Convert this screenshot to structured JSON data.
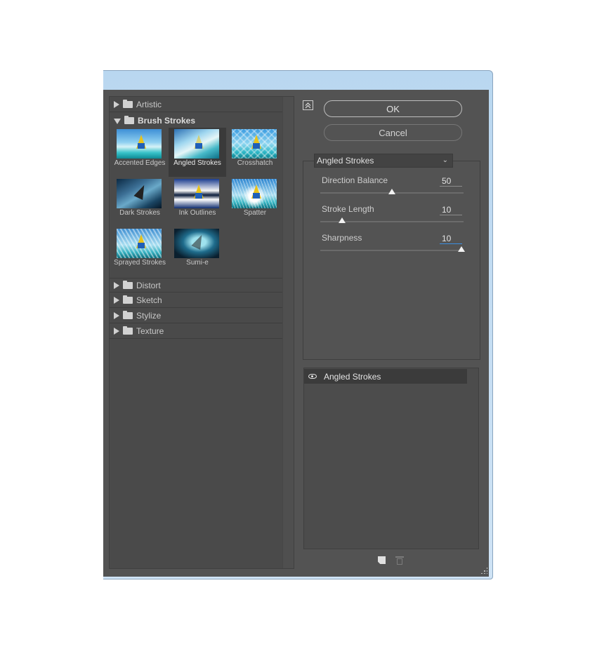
{
  "gallery": {
    "categories_top": [
      {
        "label": "Artistic",
        "expanded": false
      },
      {
        "label": "Brush Strokes",
        "expanded": true
      }
    ],
    "thumbnails": [
      {
        "label": "Accented Edges",
        "selected": false
      },
      {
        "label": "Angled Strokes",
        "selected": true
      },
      {
        "label": "Crosshatch",
        "selected": false
      },
      {
        "label": "Dark Strokes",
        "selected": false
      },
      {
        "label": "Ink Outlines",
        "selected": false
      },
      {
        "label": "Spatter",
        "selected": false
      },
      {
        "label": "Sprayed Strokes",
        "selected": false
      },
      {
        "label": "Sumi-e",
        "selected": false
      }
    ],
    "categories_bottom": [
      {
        "label": "Distort",
        "expanded": false
      },
      {
        "label": "Sketch",
        "expanded": false
      },
      {
        "label": "Stylize",
        "expanded": false
      },
      {
        "label": "Texture",
        "expanded": false
      }
    ]
  },
  "buttons": {
    "ok": "OK",
    "cancel": "Cancel",
    "collapse_icon": "collapse-up-icon"
  },
  "settings": {
    "filter_select": "Angled Strokes",
    "params": [
      {
        "label": "Direction Balance",
        "value": "50",
        "slider_fraction": 0.5
      },
      {
        "label": "Stroke Length",
        "value": "10",
        "slider_fraction": 0.14
      },
      {
        "label": "Sharpness",
        "value": "10",
        "slider_fraction": 1.0
      }
    ]
  },
  "layers": {
    "items": [
      {
        "name": "Angled Strokes",
        "visible": true
      }
    ]
  }
}
